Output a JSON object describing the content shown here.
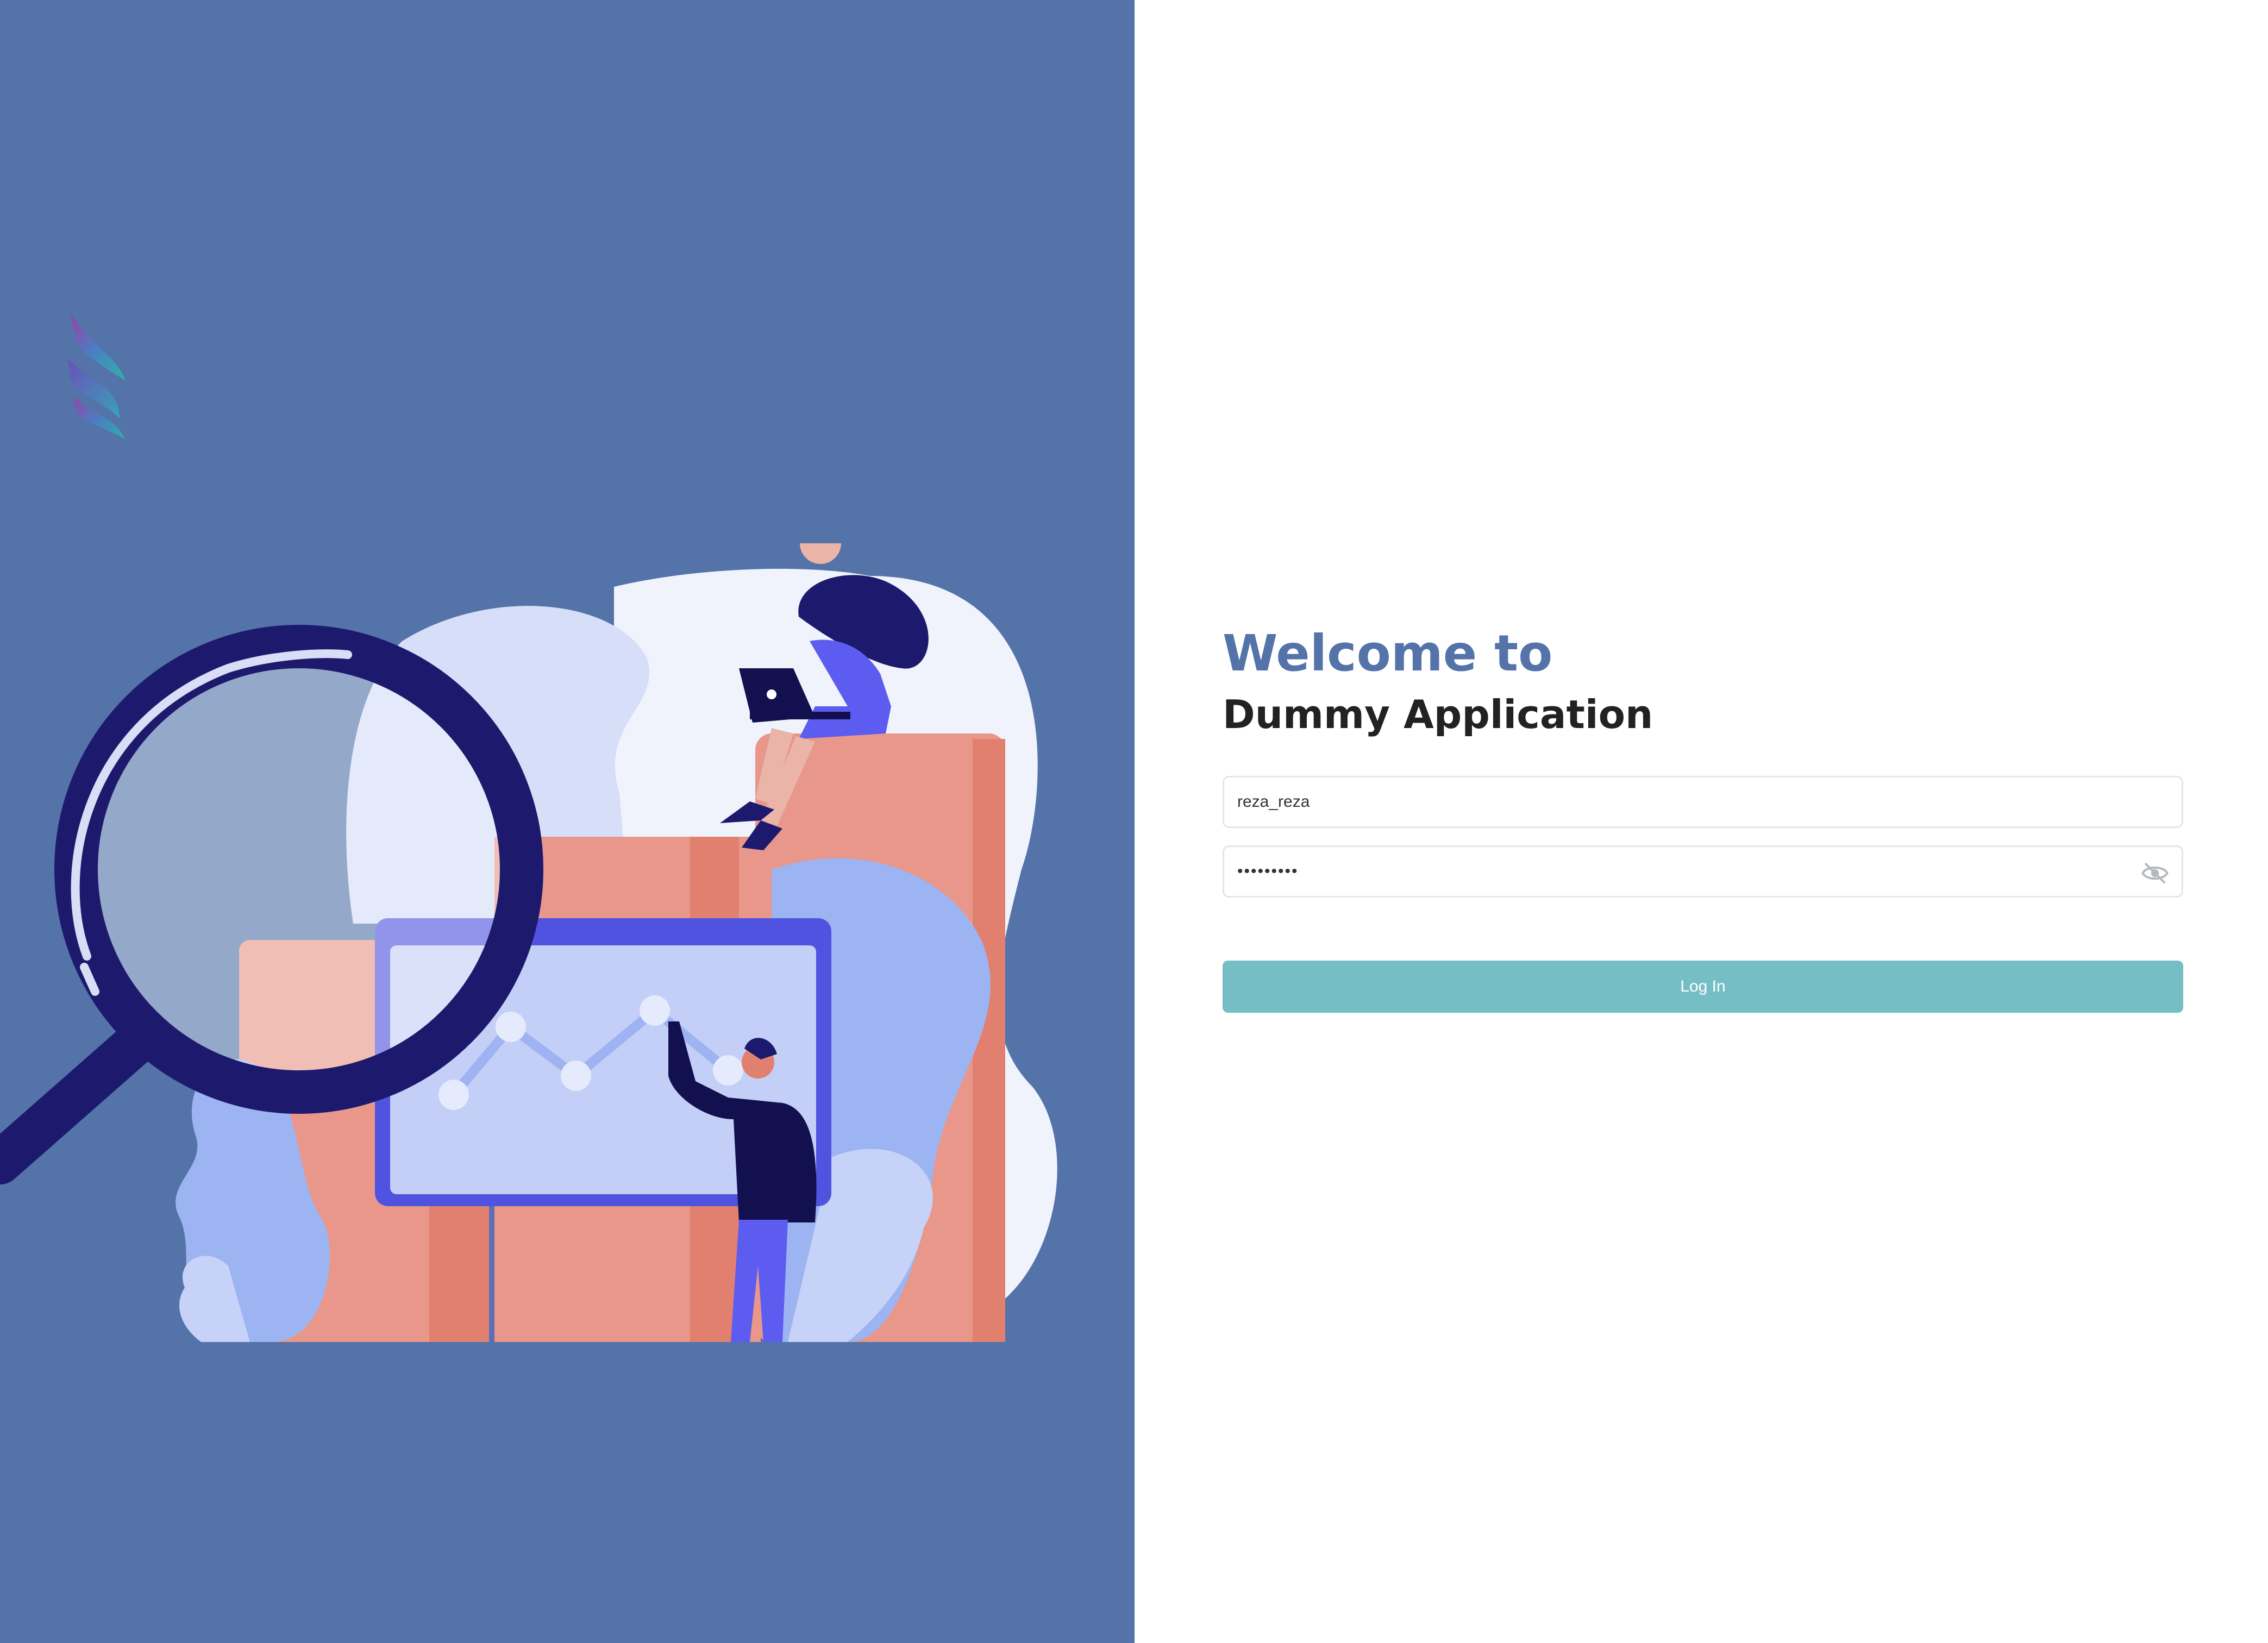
{
  "login": {
    "welcome": "Welcome to",
    "app_name": "Dummy Application",
    "username_value": "reza_reza",
    "password_value": "password1",
    "login_label": "Log In"
  },
  "icons": {
    "logo": "brand-logo",
    "password_toggle": "eye-slash-icon"
  },
  "colors": {
    "left_panel": "#5373a9",
    "heading_accent": "#5373a9",
    "login_button": "#76bec5"
  }
}
